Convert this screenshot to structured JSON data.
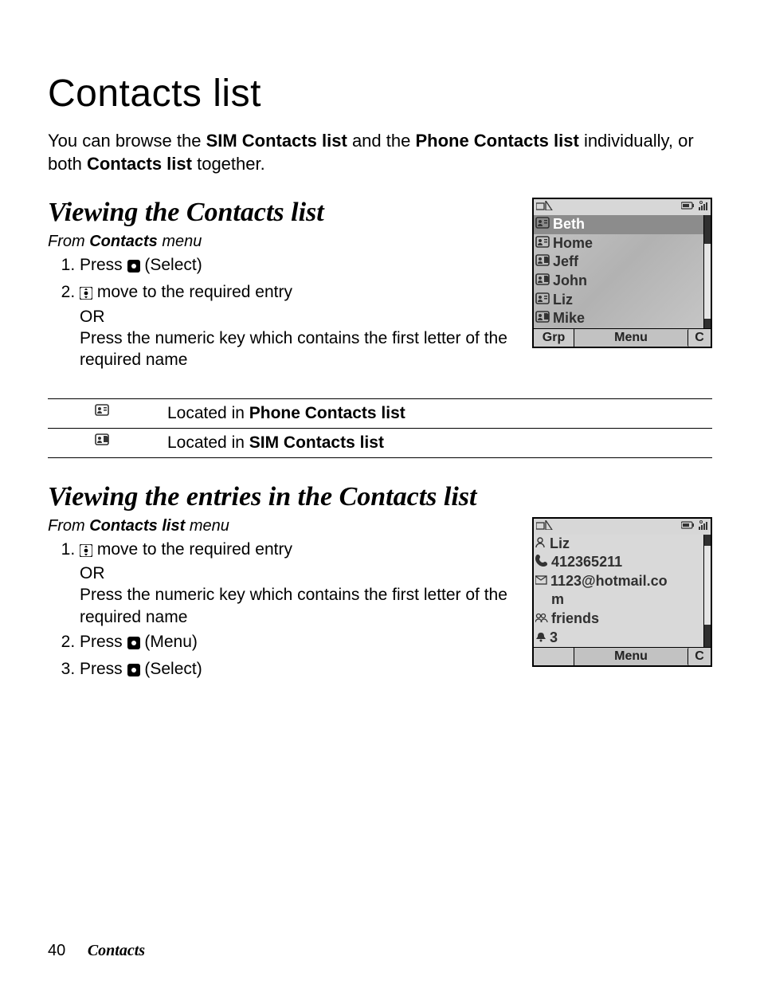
{
  "title": "Contacts list",
  "intro": {
    "pre": "You can browse the ",
    "b1": "SIM Contacts list",
    "mid": " and the ",
    "b2": "Phone Contacts list",
    "post1": " individually, or both ",
    "b3": "Contacts list",
    "post2": " together."
  },
  "section1": {
    "heading": "Viewing the Contacts list",
    "from_pre": "From ",
    "from_b": "Contacts",
    "from_post": " menu",
    "step1_pre": "Press ",
    "step1_post": " (Select)",
    "step2_pre": "",
    "step2_mid": " move to the required entry",
    "step2_or": "OR",
    "step2_post": "Press the numeric key which contains the first letter of the required name"
  },
  "legend": {
    "row1_pre": "Located in ",
    "row1_b": "Phone Contacts list",
    "row2_pre": "Located in ",
    "row2_b": "SIM Contacts list"
  },
  "section2": {
    "heading": "Viewing the entries in the Contacts list",
    "from_pre": "From ",
    "from_b": "Contacts list",
    "from_post": " menu",
    "step1_pre": "",
    "step1_mid": " move to the required entry",
    "step1_or": "OR",
    "step1_post": "Press the numeric key which contains the first letter of the required name",
    "step2_pre": "Press ",
    "step2_post": " (Menu)",
    "step3_pre": "Press ",
    "step3_post": " (Select)"
  },
  "phone1": {
    "items": [
      "Beth",
      "Home",
      "Jeff",
      "John",
      "Liz",
      "Mike"
    ],
    "soft_left": "Grp",
    "soft_mid": "Menu",
    "soft_right": "C"
  },
  "phone2": {
    "rows": {
      "name": "Liz",
      "number": "412365211",
      "email_line1": "1123@hotmail.co",
      "email_line2": "m",
      "group": "friends",
      "ring": "3"
    },
    "soft_left": "",
    "soft_mid": "Menu",
    "soft_right": "C"
  },
  "footer": {
    "page": "40",
    "section": "Contacts"
  }
}
